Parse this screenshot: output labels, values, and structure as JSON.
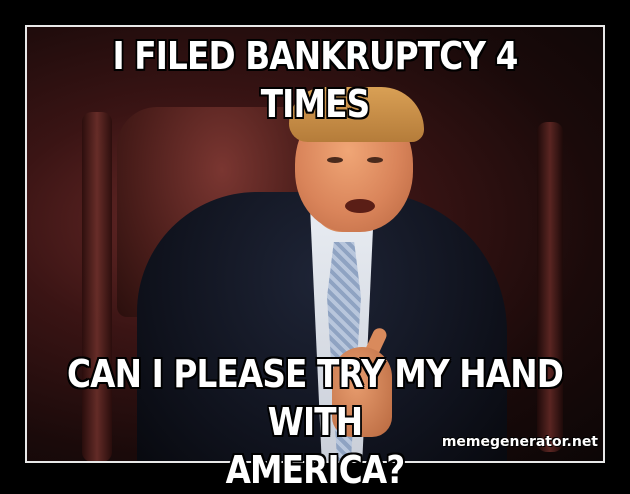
{
  "meme": {
    "top_text_line1": "I FILED BANKRUPTCY 4",
    "top_text_line2": "TIMES",
    "bottom_text_line1": "CAN I PLEASE TRY MY HAND WITH",
    "bottom_text_line2": "AMERICA?",
    "watermark": "memegenerator.net"
  }
}
